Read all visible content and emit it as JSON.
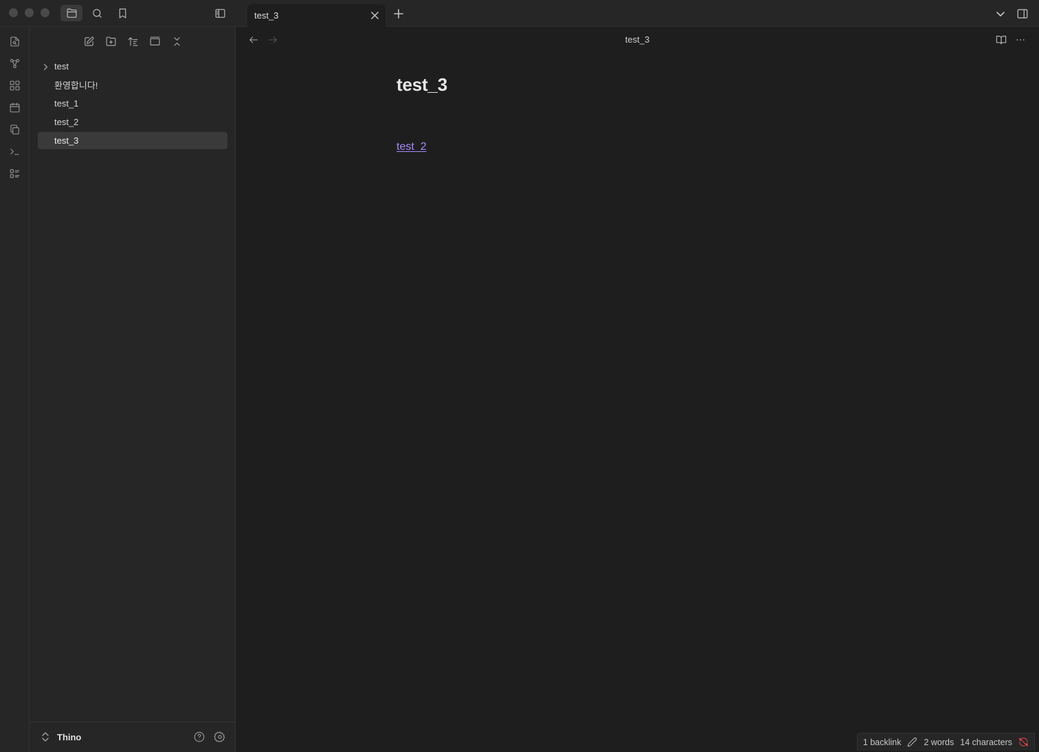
{
  "window": {
    "traffic_lights": [
      "close",
      "minimize",
      "maximize"
    ]
  },
  "sidebar_top_icons": [
    "folder-icon",
    "search-icon",
    "bookmark-icon"
  ],
  "ribbon_icons": [
    "file-search-icon",
    "graph-icon",
    "blocks-icon",
    "calendar-icon",
    "copy-icon",
    "terminal-icon",
    "list-checks-icon"
  ],
  "nav_actions": [
    "new-note-icon",
    "new-folder-icon",
    "sort-icon",
    "collapse-icon",
    "collapse-all-icon"
  ],
  "file_tree": {
    "items": [
      {
        "label": "test",
        "type": "folder",
        "active": false
      },
      {
        "label": "환영합니다!",
        "type": "file",
        "active": false
      },
      {
        "label": "test_1",
        "type": "file",
        "active": false
      },
      {
        "label": "test_2",
        "type": "file",
        "active": false
      },
      {
        "label": "test_3",
        "type": "file",
        "active": true
      }
    ]
  },
  "vault": {
    "name": "Thino"
  },
  "tabs": [
    {
      "title": "test_3",
      "active": true
    }
  ],
  "view_header": {
    "title": "test_3"
  },
  "document": {
    "heading": "test_3",
    "link": "test_2"
  },
  "status_bar": {
    "backlinks": "1 backlink",
    "words": "2 words",
    "characters": "14 characters"
  },
  "colors": {
    "accent": "#a88bfa",
    "sync_error": "#e5484d",
    "background": "#1e1e1e",
    "panel": "#262626"
  }
}
